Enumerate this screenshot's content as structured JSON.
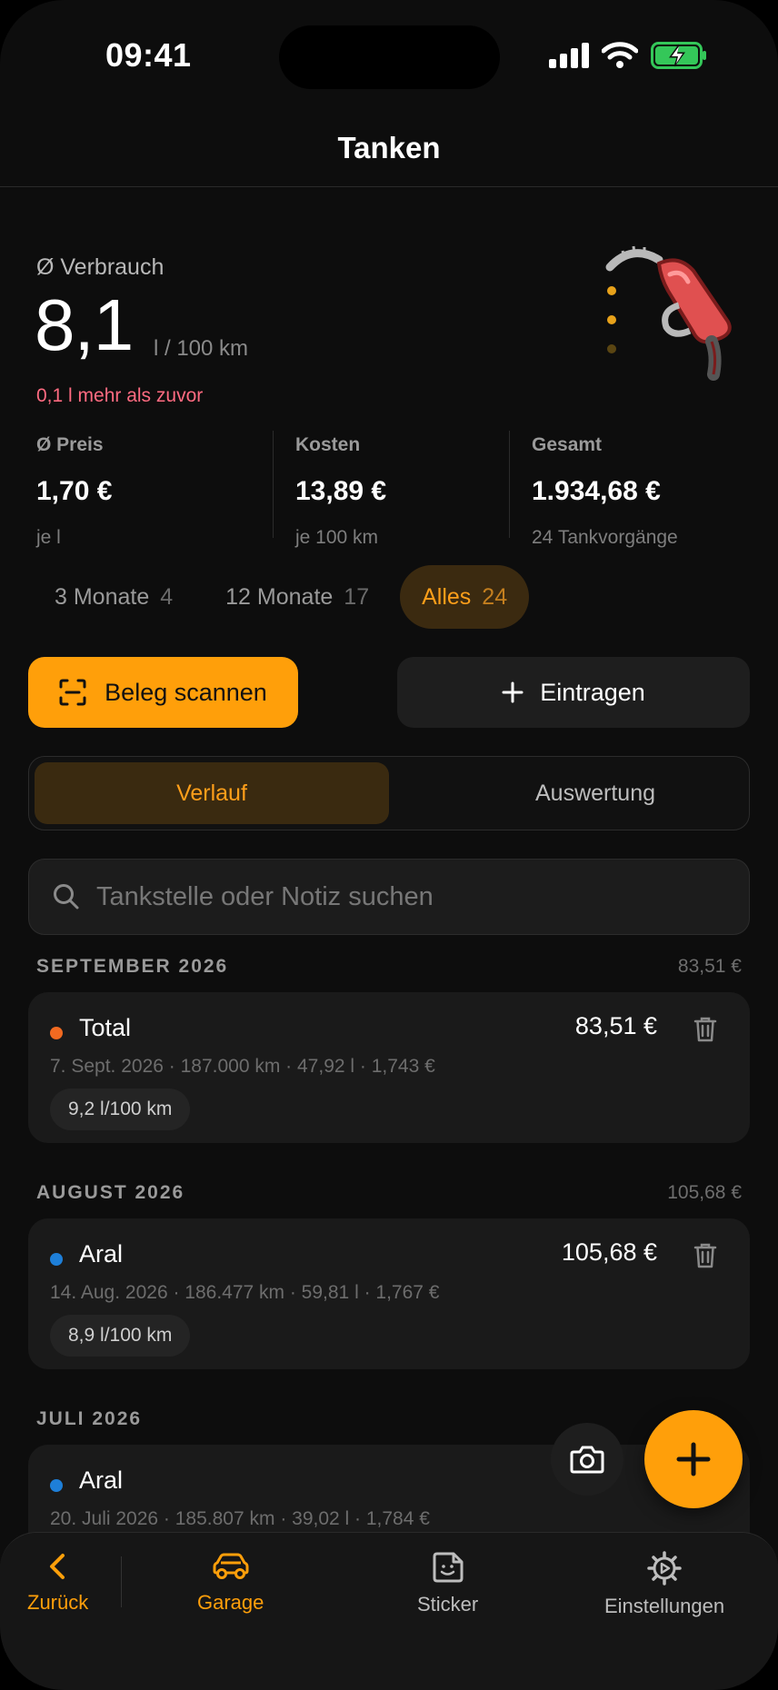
{
  "status_bar": {
    "time": "09:41"
  },
  "header": {
    "title": "Tanken"
  },
  "consumption": {
    "label": "Ø Verbrauch",
    "value": "8,1",
    "unit": "l / 100 km",
    "delta": "0,1 l mehr als zuvor"
  },
  "metrics": [
    {
      "label": "Ø Preis",
      "value": "1,70 €",
      "sub": "je l"
    },
    {
      "label": "Kosten",
      "value": "13,89 €",
      "sub": "je 100 km"
    },
    {
      "label": "Gesamt",
      "value": "1.934,68 €",
      "sub": "24 Tankvorgänge"
    }
  ],
  "periods": [
    {
      "label": "3 Monate",
      "count": "4",
      "active": false
    },
    {
      "label": "12 Monate",
      "count": "17",
      "active": false
    },
    {
      "label": "Alles",
      "count": "24",
      "active": true
    }
  ],
  "actions": {
    "scan_label": "Beleg scannen",
    "add_label": "Eintragen"
  },
  "segment": {
    "left": "Verlauf",
    "right": "Auswertung",
    "active": "left"
  },
  "search": {
    "placeholder": "Tankstelle oder Notiz suchen",
    "value": ""
  },
  "sections": [
    {
      "title": "SEPTEMBER 2026",
      "total": "83,51 €",
      "entries": [
        {
          "station": "Total",
          "dot_color": "#f26a21",
          "amount": "83,51 €",
          "meta": "7. Sept. 2026 · 187.000 km · 47,92 l · 1,743 €",
          "consumption": "9,2 l/100 km"
        }
      ]
    },
    {
      "title": "AUGUST 2026",
      "total": "105,68 €",
      "entries": [
        {
          "station": "Aral",
          "dot_color": "#1e7fd8",
          "amount": "105,68 €",
          "meta": "14. Aug. 2026 · 186.477 km · 59,81 l · 1,767 €",
          "consumption": "8,9 l/100 km"
        }
      ]
    },
    {
      "title": "JULI 2026",
      "total": "",
      "entries": [
        {
          "station": "Aral",
          "dot_color": "#1e7fd8",
          "amount": "",
          "meta": "20. Juli 2026 · 185.807 km · 39,02 l · 1,784 €",
          "consumption": ""
        }
      ]
    }
  ],
  "tabbar": [
    {
      "label": "Zurück",
      "icon": "chevron-left-icon",
      "active": true
    },
    {
      "label": "Garage",
      "icon": "car-icon",
      "active": true
    },
    {
      "label": "Sticker",
      "icon": "sticker-icon",
      "active": false
    },
    {
      "label": "Einstellungen",
      "icon": "gear-icon",
      "active": false
    }
  ],
  "colors": {
    "accent": "#ff9f0a",
    "delta_red": "#ff6b81",
    "background": "#0d0d0d"
  }
}
